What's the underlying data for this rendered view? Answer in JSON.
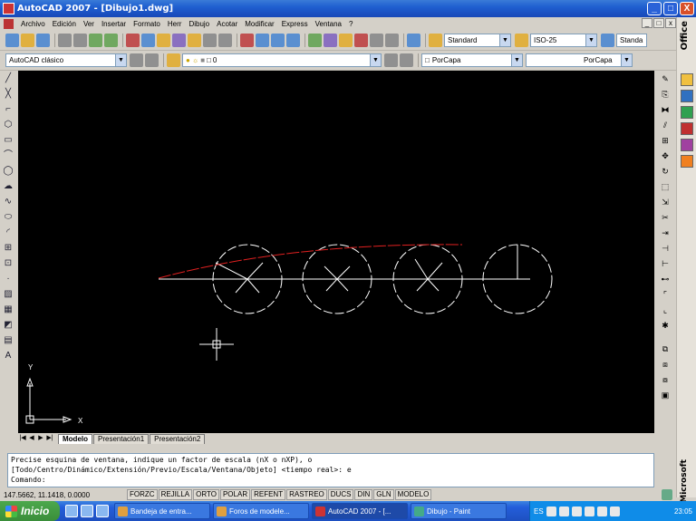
{
  "window": {
    "title": "AutoCAD 2007 - [Dibujo1.dwg]",
    "min_label": "_",
    "max_label": "□",
    "close_label": "X"
  },
  "menu": {
    "items": [
      "Archivo",
      "Edición",
      "Ver",
      "Insertar",
      "Formato",
      "Herr",
      "Dibujo",
      "Acotar",
      "Modificar",
      "Express",
      "Ventana",
      "?"
    ],
    "doc_controls": [
      "_",
      "□",
      "x"
    ]
  },
  "toolbar1": {
    "text_style": "Standard",
    "dim_style": "ISO-25",
    "table_style": "Standa"
  },
  "toolbar2": {
    "workspace": "AutoCAD clásico",
    "layer": "0",
    "color": "PorCapa",
    "linetype": "PorCapa"
  },
  "office": {
    "top_label": "Office",
    "bottom_label": "Microsoft",
    "icon_colors": [
      "#f0c040",
      "#3070c0",
      "#30a050",
      "#c03030",
      "#a040a0",
      "#f08020"
    ]
  },
  "ucs": {
    "x_label": "X",
    "y_label": "Y"
  },
  "layout_tabs": {
    "nav": [
      "|◀",
      "◀",
      "▶",
      "▶|"
    ],
    "tabs": [
      "Modelo",
      "Presentación1",
      "Presentación2"
    ]
  },
  "command": {
    "lines": [
      "Precise esquina de ventana, indique un factor de escala (nX o nXP), o",
      "[Todo/Centro/Dinámico/Extensión/Previo/Escala/Ventana/Objeto] <tiempo real>: e",
      "Comando:"
    ]
  },
  "status": {
    "coords": "147.5662, 11.1418, 0.0000",
    "buttons": [
      "FORZC",
      "REJILLA",
      "ORTO",
      "POLAR",
      "REFENT",
      "RASTREO",
      "DUCS",
      "DIN",
      "GLN",
      "MODELO"
    ]
  },
  "taskbar": {
    "start_label": "Inicio",
    "tasks": [
      "Bandeja de entra...",
      "Foros de modele...",
      "AutoCAD 2007 - [...",
      "Dibujo - Paint"
    ],
    "tray_lang": "ES",
    "clock": "23:05"
  },
  "colors": {
    "drawing_bg": "#000000",
    "geometry": "#ffffff",
    "accent_curve": "#e02020"
  }
}
